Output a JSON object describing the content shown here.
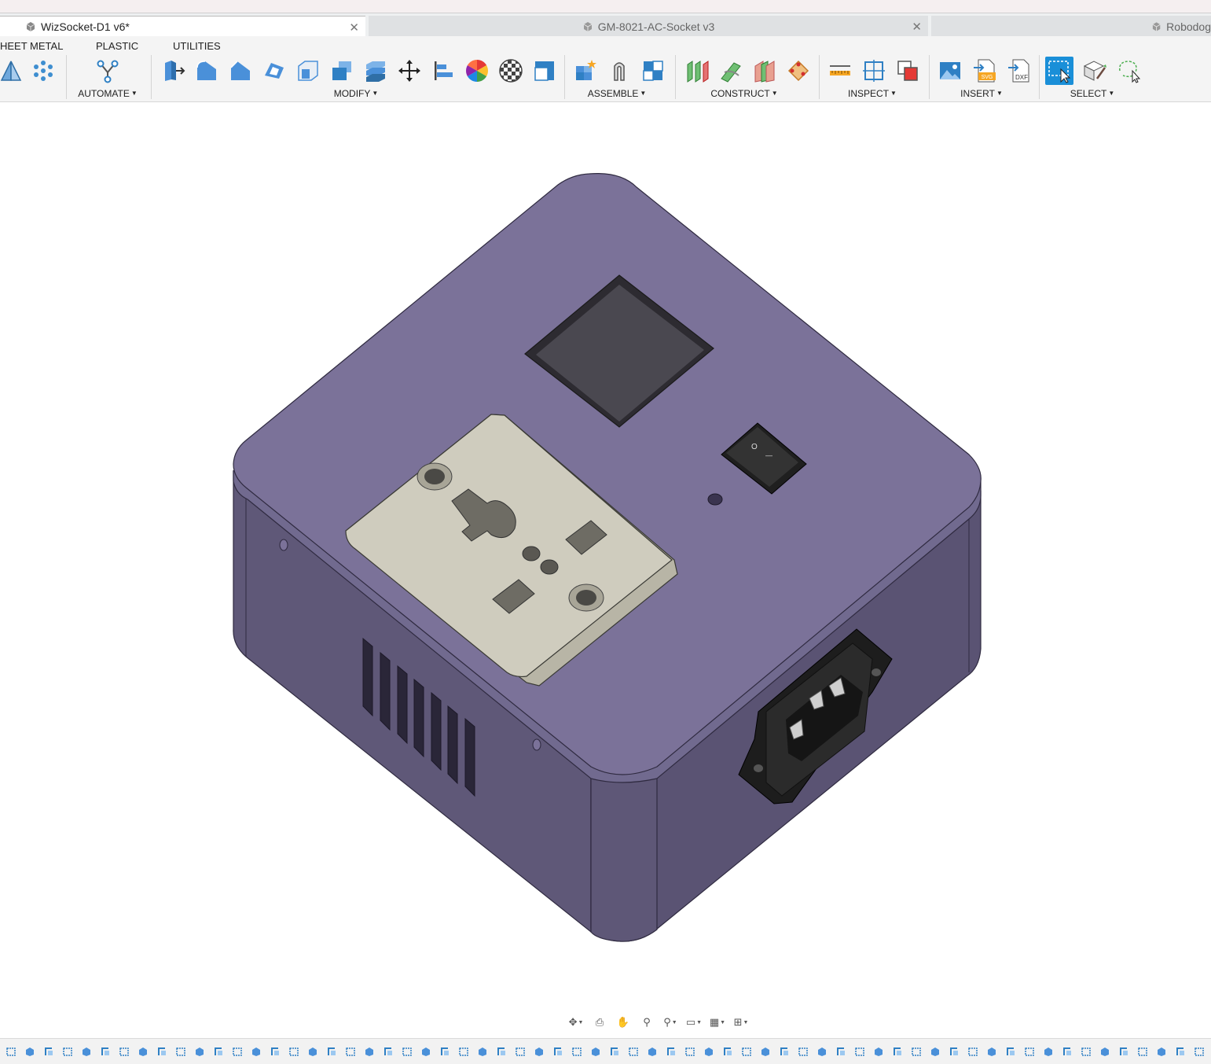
{
  "tabs": [
    {
      "name": "WizSocket-D1 v6*",
      "active": true
    },
    {
      "name": "GM-8021-AC-Socket v3",
      "active": false
    },
    {
      "name": "Robodog",
      "active": false
    }
  ],
  "ribbon": {
    "tabs": [
      "HEET METAL",
      "PLASTIC",
      "UTILITIES"
    ],
    "groups": {
      "automate": "AUTOMATE",
      "modify": "MODIFY",
      "assemble": "ASSEMBLE",
      "construct": "CONSTRUCT",
      "inspect": "INSPECT",
      "insert": "INSERT",
      "select": "SELECT"
    },
    "insert_badges": {
      "svg": "SVG",
      "dxf": "DXF"
    }
  },
  "switch_labels": {
    "off": "O",
    "on": "—"
  },
  "colors": {
    "accent": "#1a8fd8",
    "enclosure_top": "#7b7299",
    "enclosure_side": "#5f5878",
    "socket_plate": "#cfccbe",
    "display_window": "#3d3b40"
  },
  "icons": {
    "nav": [
      "orbit-icon",
      "look-at-icon",
      "pan-icon",
      "zoom-icon",
      "fit-icon",
      "display-settings-icon",
      "grid-icon",
      "viewports-icon"
    ]
  }
}
